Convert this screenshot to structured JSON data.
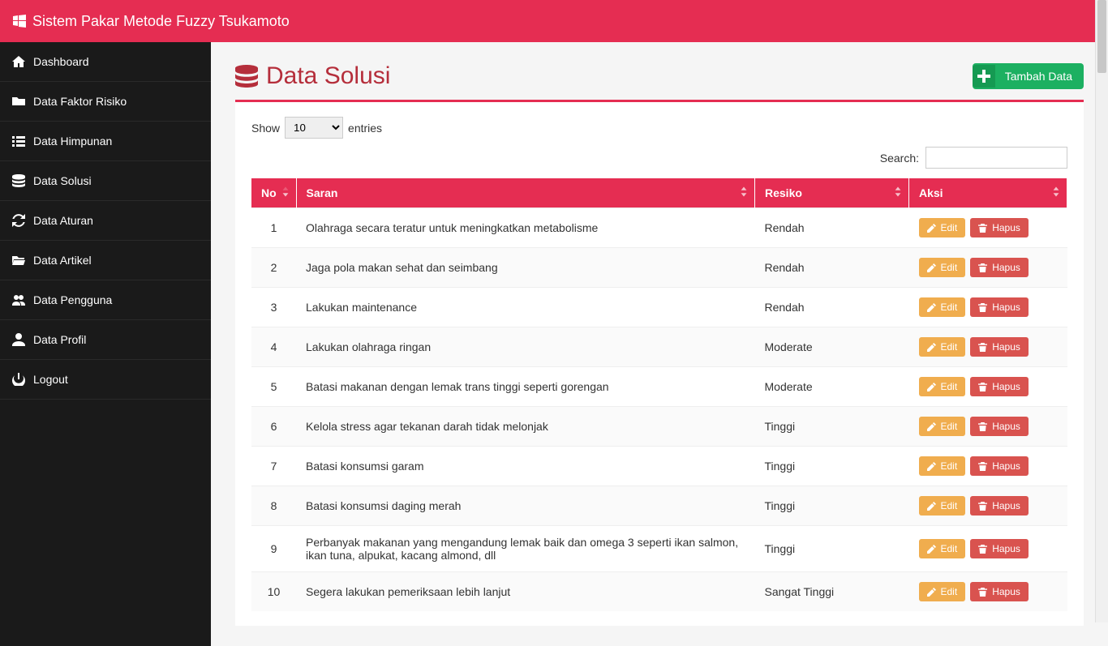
{
  "brand": "Sistem Pakar Metode Fuzzy Tsukamoto",
  "sidebar": {
    "items": [
      {
        "label": "Dashboard",
        "icon": "home"
      },
      {
        "label": "Data Faktor Risiko",
        "icon": "folder"
      },
      {
        "label": "Data Himpunan",
        "icon": "list"
      },
      {
        "label": "Data Solusi",
        "icon": "database"
      },
      {
        "label": "Data Aturan",
        "icon": "refresh"
      },
      {
        "label": "Data Artikel",
        "icon": "folder-open"
      },
      {
        "label": "Data Pengguna",
        "icon": "users"
      },
      {
        "label": "Data Profil",
        "icon": "user"
      },
      {
        "label": "Logout",
        "icon": "power"
      }
    ]
  },
  "page": {
    "title": "Data Solusi",
    "add_label": "Tambah Data"
  },
  "table": {
    "show_label": "Show",
    "entries_label": "entries",
    "length_value": "10",
    "search_label": "Search:",
    "search_value": "",
    "headers": {
      "no": "No",
      "saran": "Saran",
      "resiko": "Resiko",
      "aksi": "Aksi"
    },
    "edit_label": "Edit",
    "hapus_label": "Hapus",
    "rows": [
      {
        "no": "1",
        "saran": "Olahraga secara teratur untuk meningkatkan metabolisme",
        "resiko": "Rendah"
      },
      {
        "no": "2",
        "saran": "Jaga pola makan sehat dan seimbang",
        "resiko": "Rendah"
      },
      {
        "no": "3",
        "saran": "Lakukan maintenance",
        "resiko": "Rendah"
      },
      {
        "no": "4",
        "saran": "Lakukan olahraga ringan",
        "resiko": "Moderate"
      },
      {
        "no": "5",
        "saran": "Batasi makanan dengan lemak trans tinggi seperti gorengan",
        "resiko": "Moderate"
      },
      {
        "no": "6",
        "saran": "Kelola stress agar tekanan darah tidak melonjak",
        "resiko": "Tinggi"
      },
      {
        "no": "7",
        "saran": "Batasi konsumsi garam",
        "resiko": "Tinggi"
      },
      {
        "no": "8",
        "saran": "Batasi konsumsi daging merah",
        "resiko": "Tinggi"
      },
      {
        "no": "9",
        "saran": "Perbanyak makanan yang mengandung lemak baik dan omega 3 seperti ikan salmon, ikan tuna, alpukat, kacang almond, dll",
        "resiko": "Tinggi"
      },
      {
        "no": "10",
        "saran": "Segera lakukan pemeriksaan lebih lanjut",
        "resiko": "Sangat Tinggi"
      }
    ]
  }
}
